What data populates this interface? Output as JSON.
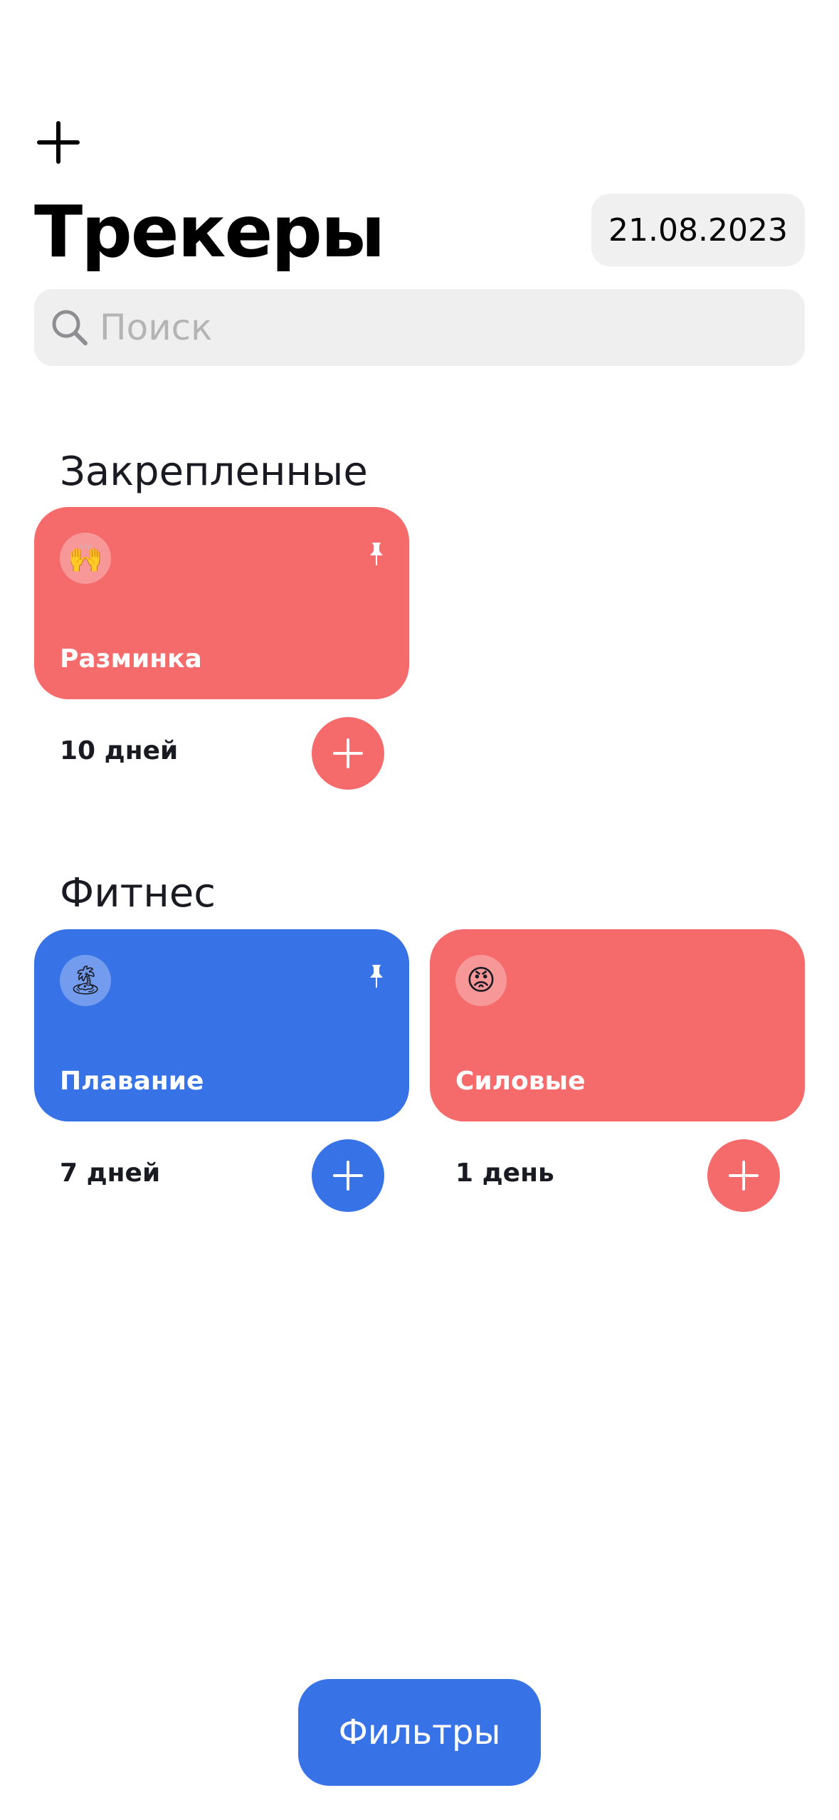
{
  "header": {
    "add_icon": "plus-icon",
    "title": "Трекеры",
    "date": "21.08.2023"
  },
  "search": {
    "placeholder": "Поиск",
    "value": "",
    "icon": "search-icon"
  },
  "sections": [
    {
      "title": "Закрепленные",
      "trackers": [
        {
          "name": "Разминка",
          "emoji": "🙌",
          "color": "#F56B6C",
          "pinned": true,
          "days": "10 дней"
        }
      ]
    },
    {
      "title": "Фитнес",
      "trackers": [
        {
          "name": "Плавание",
          "emoji": "🏝",
          "color": "#3772E7",
          "pinned": true,
          "days": "7 дней"
        },
        {
          "name": "Силовые",
          "emoji": "😡",
          "color": "#F56B6C",
          "pinned": false,
          "days": "1 день"
        }
      ]
    }
  ],
  "filters": {
    "label": "Фильтры",
    "color": "#3772E7"
  },
  "colors": {
    "text": "#1A1B22",
    "search_bg": "#EFEFEF",
    "placeholder": "#B4B4B4",
    "red": "#F56B6C",
    "blue": "#3772E7"
  }
}
